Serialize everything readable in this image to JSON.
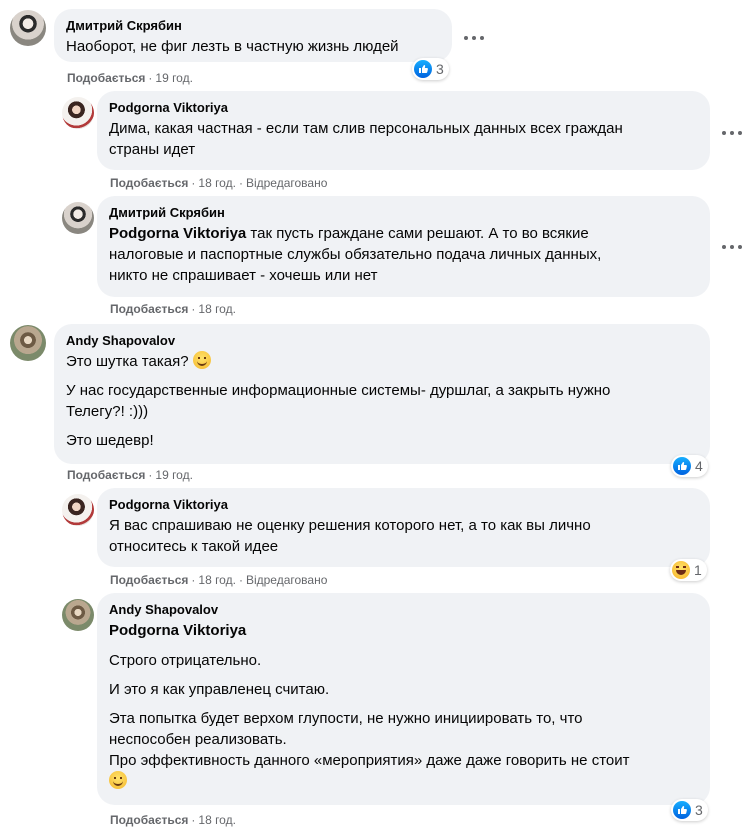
{
  "comments": [
    {
      "author": "Дмитрий Скрябин",
      "lines": [
        "Наоборот, не фиг лезть в частную жизнь людей"
      ],
      "like_label": "Подобається",
      "time": "19 год.",
      "reaction_count": "3"
    },
    {
      "author": "Podgorna Viktoriya",
      "lines": [
        "Дима, какая частная - если там слив персональных данных всех граждан",
        "страны идет"
      ],
      "like_label": "Подобається",
      "time": "18 год.",
      "edited": "Відредаговано"
    },
    {
      "author": "Дмитрий Скрябин",
      "mention": "Podgorna Viktoriya",
      "lines": [
        " так пусть граждане сами решают. А то во всякие",
        "налоговые и паспортные службы обязательно подача личных данных,",
        "никто не спрашивает - хочешь или нет"
      ],
      "like_label": "Подобається",
      "time": "18 год."
    },
    {
      "author": "Andy Shapovalov",
      "p1": "Это шутка такая?",
      "p2a": "У нас государственные информационные системы- дуршлаг, а закрыть нужно",
      "p2b": "Телегу?! :)))",
      "p3": "Это шедевр!",
      "like_label": "Подобається",
      "time": "19 год.",
      "reaction_count": "4"
    },
    {
      "author": "Podgorna Viktoriya",
      "lines": [
        "Я вас спрашиваю не оценку решения которого нет, а то как вы лично",
        "относитесь к такой идее"
      ],
      "like_label": "Подобається",
      "time": "18 год.",
      "edited": "Відредаговано",
      "reaction_count": "1"
    },
    {
      "author": "Andy Shapovalov",
      "mention": "Podgorna Viktoriya",
      "p1": "Строго отрицательно.",
      "p2": "И это я как управленец считаю.",
      "p3a": "Эта попытка будет верхом глупости, не нужно инициировать то, что",
      "p3b": "неспособен реализовать.",
      "p3c": "Про эффективность данного «мероприятия» даже даже говорить не стоит",
      "like_label": "Подобається",
      "time": "18 год.",
      "reaction_count": "3"
    }
  ],
  "colors": {
    "bubble": "#f0f2f5",
    "meta": "#65676b",
    "like_blue": "#1877f2"
  }
}
